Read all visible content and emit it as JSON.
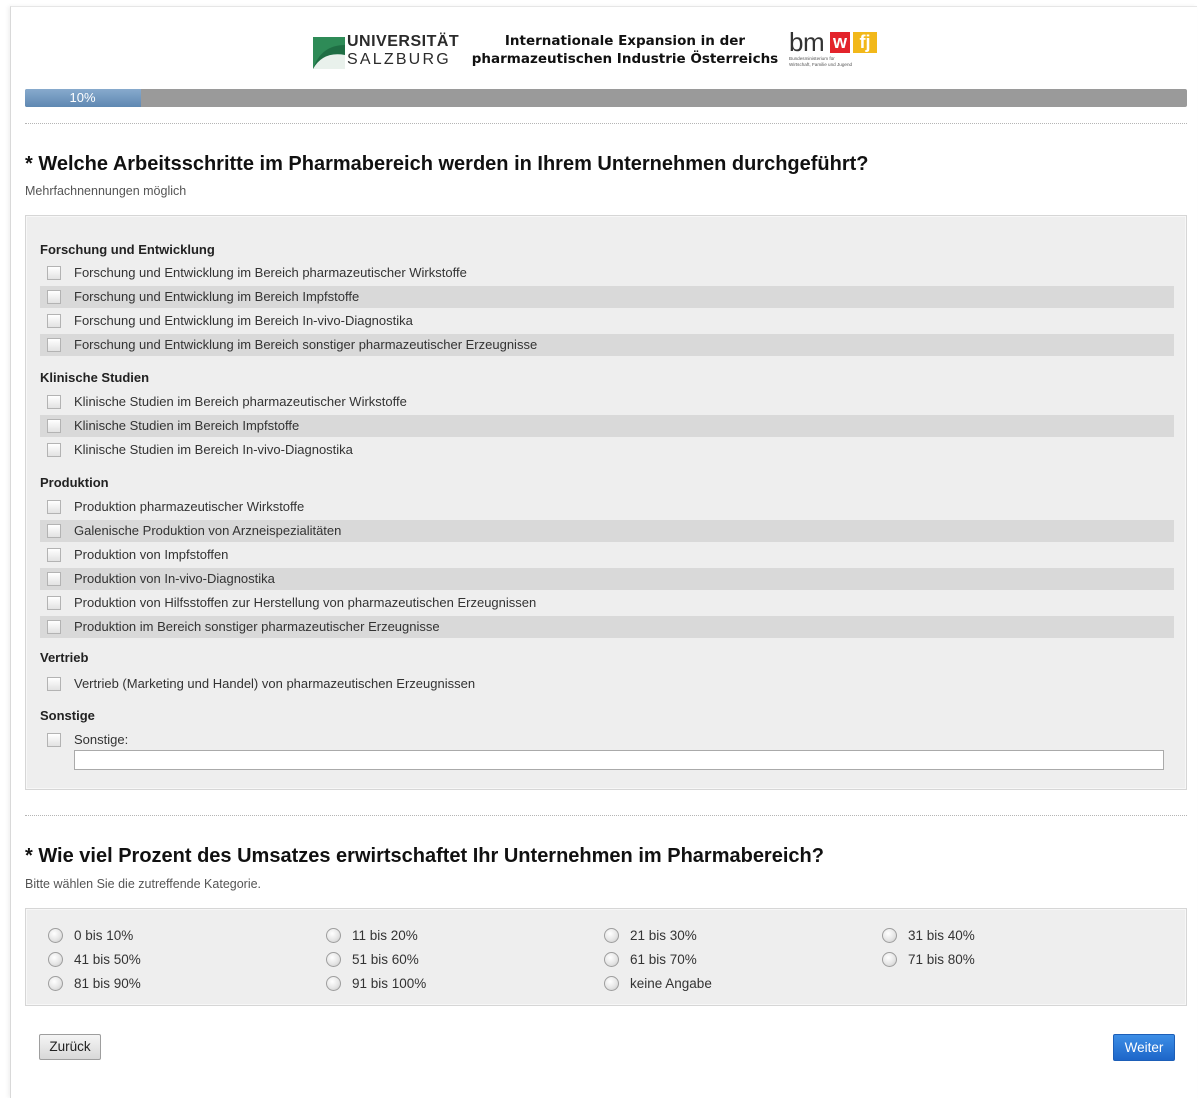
{
  "header": {
    "university_line1": "UNIVERSITÄT",
    "university_line2": "SALZBURG",
    "title_line1": "Internationale Expansion in der",
    "title_line2": "pharmazeutischen Industrie Österreichs",
    "ministry_bm": "bm",
    "ministry_w": "w",
    "ministry_fj": "fj",
    "ministry_sub1": "Bundesministerium für",
    "ministry_sub2": "Wirtschaft, Familie und Jugend"
  },
  "progress": {
    "label": "10%",
    "percent": 10
  },
  "q1": {
    "title": "* Welche Arbeitsschritte im Pharmabereich werden in Ihrem Unternehmen durchgeführt?",
    "hint": "Mehrfachnennungen möglich",
    "groups": [
      {
        "label": "Forschung und Entwicklung",
        "options": [
          "Forschung und Entwicklung im Bereich pharmazeutischer Wirkstoffe",
          "Forschung und Entwicklung im Bereich Impfstoffe",
          "Forschung und Entwicklung im Bereich In-vivo-Diagnostika",
          "Forschung und Entwicklung im Bereich sonstiger pharmazeutischer Erzeugnisse"
        ]
      },
      {
        "label": "Klinische Studien",
        "options": [
          "Klinische Studien im Bereich pharmazeutischer Wirkstoffe",
          "Klinische Studien im Bereich Impfstoffe",
          "Klinische Studien im Bereich In-vivo-Diagnostika"
        ]
      },
      {
        "label": "Produktion",
        "options": [
          "Produktion pharmazeutischer Wirkstoffe",
          "Galenische Produktion von Arzneispezialitäten",
          "Produktion von Impfstoffen",
          "Produktion von In-vivo-Diagnostika",
          "Produktion von Hilfsstoffen zur Herstellung von pharmazeutischen Erzeugnissen",
          "Produktion im Bereich sonstiger pharmazeutischer Erzeugnisse"
        ]
      },
      {
        "label": "Vertrieb",
        "options": [
          "Vertrieb (Marketing und Handel) von pharmazeutischen Erzeugnissen"
        ]
      },
      {
        "label": "Sonstige",
        "options": [
          "Sonstige:"
        ]
      }
    ],
    "other_value": ""
  },
  "q2": {
    "title": "* Wie viel Prozent des Umsatzes erwirtschaftet Ihr Unternehmen im Pharmabereich?",
    "hint": "Bitte wählen Sie die zutreffende Kategorie.",
    "options": [
      "0 bis 10%",
      "11 bis 20%",
      "21 bis 30%",
      "31 bis 40%",
      "41 bis 50%",
      "51 bis 60%",
      "61 bis 70%",
      "71 bis 80%",
      "81 bis 90%",
      "91 bis 100%",
      "keine Angabe"
    ]
  },
  "nav": {
    "back_label": "Zurück",
    "next_label": "Weiter"
  }
}
